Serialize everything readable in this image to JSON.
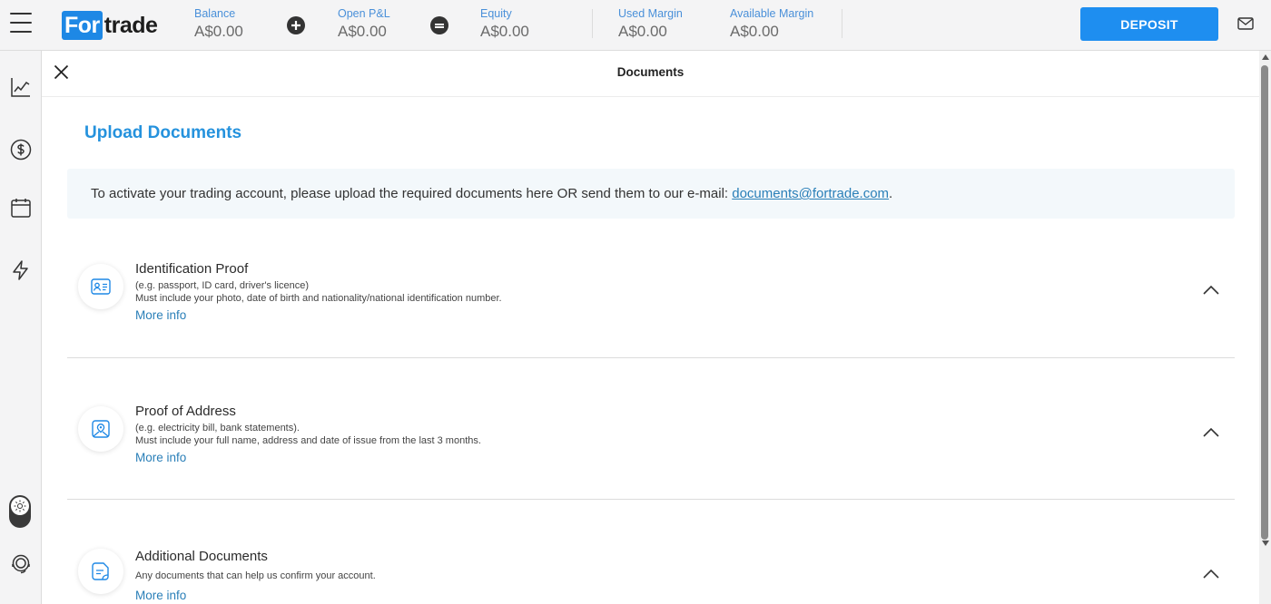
{
  "app": {
    "logo_part1": "For",
    "logo_part2": "trade",
    "accent_color": "#1e8ef0"
  },
  "topbar": {
    "stats": [
      {
        "label": "Balance",
        "value": "A$0.00"
      },
      {
        "label": "Open P&L",
        "value": "A$0.00"
      },
      {
        "label": "Equity",
        "value": "A$0.00"
      },
      {
        "label": "Used Margin",
        "value": "A$0.00"
      },
      {
        "label": "Available Margin",
        "value": "A$0.00"
      }
    ],
    "deposit_label": "DEPOSIT",
    "icons": [
      "menu-icon",
      "plus-circle-icon",
      "equals-circle-icon",
      "mail-icon"
    ]
  },
  "sidebar": {
    "items": [
      "chart-line-icon",
      "dollar-circle-icon",
      "calendar-icon",
      "lightning-icon",
      "theme-toggle-icon",
      "support-headset-icon"
    ]
  },
  "panel": {
    "title": "Documents",
    "upload_title": "Upload Documents",
    "notice_text": "To activate your trading account, please upload the required documents here OR send them to our e-mail: ",
    "notice_email": "documents@fortrade.com",
    "notice_end": "."
  },
  "documents": [
    {
      "title": "Identification Proof",
      "line1": "(e.g. passport, ID card, driver's licence)",
      "line2": "Must include your photo, date of birth and nationality/national identification number.",
      "more": "More info",
      "icon": "id-card-icon"
    },
    {
      "title": "Proof of Address",
      "line1": "(e.g. electricity bill, bank statements).",
      "line2": "Must include your full name, address and date of issue from the last 3 months.",
      "more": "More info",
      "icon": "map-pin-icon"
    },
    {
      "title": "Additional Documents",
      "line1": "Any documents that can help us confirm your account.",
      "line2": "",
      "more": "More info",
      "icon": "document-icon"
    }
  ]
}
